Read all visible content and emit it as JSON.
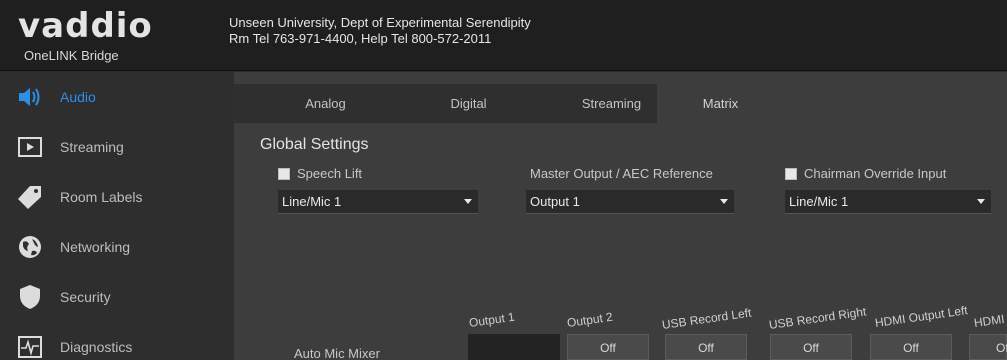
{
  "header": {
    "logo_text": "vaddio",
    "product": "OneLINK Bridge",
    "org_line1": "Unseen University, Dept of Experimental Serendipity",
    "org_line2": "Rm Tel 763-971-4400, Help Tel 800-572-2011"
  },
  "sidebar": {
    "items": [
      {
        "label": "Audio",
        "icon": "speaker-icon",
        "active": true
      },
      {
        "label": "Streaming",
        "icon": "play-icon",
        "active": false
      },
      {
        "label": "Room Labels",
        "icon": "tag-icon",
        "active": false
      },
      {
        "label": "Networking",
        "icon": "globe-icon",
        "active": false
      },
      {
        "label": "Security",
        "icon": "shield-icon",
        "active": false
      },
      {
        "label": "Diagnostics",
        "icon": "pulse-icon",
        "active": false
      }
    ]
  },
  "tabs": [
    {
      "label": "Analog",
      "active": false
    },
    {
      "label": "Digital",
      "active": false
    },
    {
      "label": "Streaming",
      "active": false
    },
    {
      "label": "Matrix",
      "active": true
    }
  ],
  "global_settings": {
    "title": "Global Settings",
    "speech_lift_label": "Speech Lift",
    "speech_lift_select": "Line/Mic 1",
    "master_output_label": "Master Output / AEC Reference",
    "master_output_select": "Output 1",
    "chairman_label": "Chairman Override Input",
    "chairman_select": "Line/Mic 1"
  },
  "matrix": {
    "columns": [
      "Output 1",
      "Output 2",
      "USB Record Left",
      "USB Record Right",
      "HDMI Output Left",
      "HDMI"
    ],
    "row_label": "Auto Mic Mixer",
    "cell_value": "Off"
  },
  "colors": {
    "accent": "#2e8fe6",
    "header_bg": "#1f1f1f",
    "sidebar_bg": "#2e2e2e",
    "main_bg": "#3d3d3d"
  }
}
